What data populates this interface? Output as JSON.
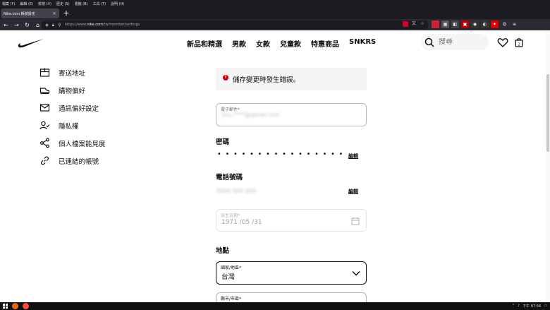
{
  "browser": {
    "menu": [
      "檔案 (F)",
      "編輯 (E)",
      "檢視 (V)",
      "歷史 (S)",
      "書籤 (B)",
      "工具 (T)",
      "說明 (H)"
    ],
    "tab_title": "Nike.com 帳號設定",
    "url_prefix": "https://www.",
    "url_domain": "nike.com",
    "url_path": "/tw/member/settings"
  },
  "header": {
    "nav": [
      "新品和精選",
      "男款",
      "女款",
      "兒童款",
      "特惠商品",
      "SNKRS"
    ],
    "search_placeholder": "搜尋",
    "bag_count": "2"
  },
  "sidebar": {
    "items": [
      {
        "label": "寄送地址",
        "icon": "address-book-icon"
      },
      {
        "label": "購物偏好",
        "icon": "shoe-icon"
      },
      {
        "label": "通訊偏好設定",
        "icon": "envelope-icon"
      },
      {
        "label": "隱私權",
        "icon": "user-check-icon"
      },
      {
        "label": "個人檔案能見度",
        "icon": "share-icon"
      },
      {
        "label": "已連結的帳號",
        "icon": "link-icon"
      }
    ]
  },
  "settings": {
    "error_message": "儲存變更時發生錯誤。",
    "email_label": "電子郵件*",
    "email_value": "you.****@gmail.com",
    "password_title": "密碼",
    "password_dots": "••••••••••••••••",
    "password_edit": "編輯",
    "phone_title": "電話號碼",
    "phone_value": "0900 000 000",
    "phone_edit": "編輯",
    "dob_label": "出生日期*",
    "dob_value": "1971 /05 /31",
    "location_title": "地點",
    "country_label": "國家/地區*",
    "country_value": "台灣",
    "county_label": "縣市/市區*"
  },
  "taskbar": {
    "clock": "下午 07:56"
  }
}
